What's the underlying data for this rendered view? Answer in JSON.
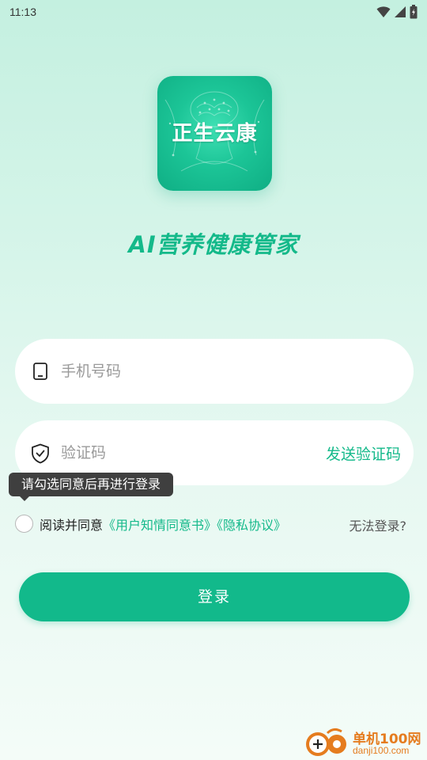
{
  "status_bar": {
    "time": "11:13",
    "icons": [
      "wifi-icon",
      "signal-icon",
      "battery-icon"
    ]
  },
  "app": {
    "logo_text": "正生云康",
    "tagline": "AI营养健康管家",
    "accent_color": "#14b98a"
  },
  "form": {
    "phone_placeholder": "手机号码",
    "phone_value": "",
    "code_placeholder": "验证码",
    "code_value": "",
    "send_code_label": "发送验证码"
  },
  "tooltip": {
    "text": "请勾选同意后再进行登录"
  },
  "agreement": {
    "prefix": "阅读并同意",
    "user_consent_link": "《用户知情同意书》",
    "privacy_link": "《隐私协议》",
    "checked": false
  },
  "cannot_login_label": "无法登录?",
  "login_button_label": "登录",
  "watermark": {
    "title": "单机100网",
    "subtitle": "danji100.com"
  }
}
